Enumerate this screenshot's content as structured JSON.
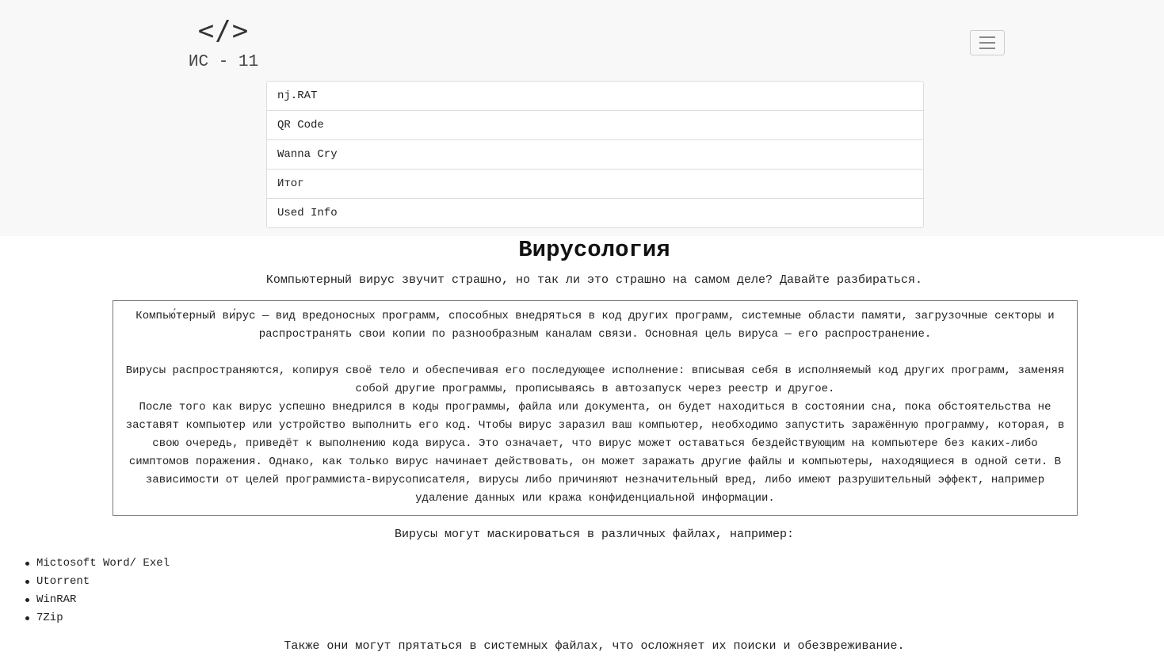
{
  "header": {
    "logo_mark": "</>",
    "logo_text": "ИС - 11",
    "menu_toggle_icon": "hamburger-icon",
    "nav": [
      {
        "label": "nj.RAT"
      },
      {
        "label": "QR Code"
      },
      {
        "label": "Wanna Cry"
      },
      {
        "label": "Итог"
      },
      {
        "label": "Used Info"
      }
    ]
  },
  "main": {
    "title": "Вирусология",
    "intro": "Компьютерный вирус звучит страшно, но так ли это страшно на самом деле? Давайте разбираться.",
    "info_box": {
      "paragraph_1": "Компью́терный ви́рус — вид вредоносных программ, способных внедряться в код других программ, системные области памяти, загрузочные секторы и распространять свои копии по разнообразным каналам связи. Основная цель вируса — его распространение.",
      "paragraph_2": "Вирусы распространяются, копируя своё тело и обеспечивая его последующее исполнение: вписывая себя в исполняемый код других программ, заменяя собой другие программы, прописываясь в автозапуск через реестр и другое.",
      "paragraph_3": "После того как вирус успешно внедрился в коды программы, файла или документа, он будет находиться в состоянии сна, пока обстоятельства не заставят компьютер или устройство выполнить его код. Чтобы вирус заразил ваш компьютер, необходимо запустить заражённую программу, которая, в свою очередь, приведёт к выполнению кода вируса. Это означает, что вирус может оставаться бездействующим на компьютере без каких-либо симптомов поражения. Однако, как только вирус начинает действовать, он может заражать другие файлы и компьютеры, находящиеся в одной сети. В зависимости от целей программиста-вирусописателя, вирусы либо причиняют незначительный вред, либо имеют разрушительный эффект, например удаление данных или кража конфиденциальной информации."
    },
    "mask_text": "Вирусы могут маскироваться в различных файлах, например:",
    "files": [
      "Mictosoft Word/ Exel",
      "Utorrent",
      "WinRAR",
      "7Zip"
    ],
    "outro": "Также они могут прятаться в системных файлах, что осложняет их поиски и обезвреживание."
  }
}
